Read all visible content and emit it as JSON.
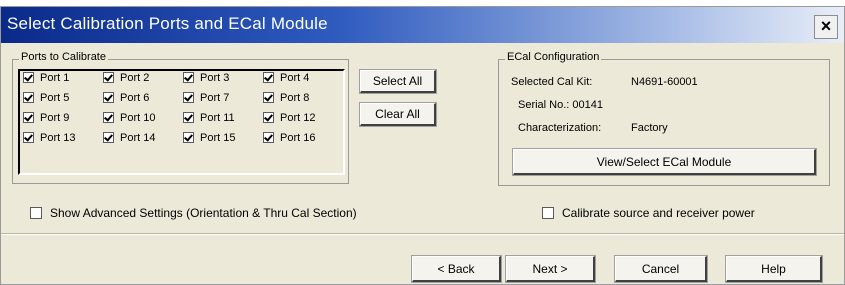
{
  "window": {
    "title": "Select Calibration Ports and ECal Module",
    "close_label": "×"
  },
  "ports_group": {
    "legend": "Ports to Calibrate",
    "ports": [
      {
        "label": "Port 1",
        "checked": true
      },
      {
        "label": "Port 2",
        "checked": true
      },
      {
        "label": "Port 3",
        "checked": true
      },
      {
        "label": "Port 4",
        "checked": true
      },
      {
        "label": "Port 5",
        "checked": true
      },
      {
        "label": "Port 6",
        "checked": true
      },
      {
        "label": "Port 7",
        "checked": true
      },
      {
        "label": "Port 8",
        "checked": true
      },
      {
        "label": "Port 9",
        "checked": true
      },
      {
        "label": "Port 10",
        "checked": true
      },
      {
        "label": "Port 11",
        "checked": true
      },
      {
        "label": "Port 12",
        "checked": true
      },
      {
        "label": "Port 13",
        "checked": true
      },
      {
        "label": "Port 14",
        "checked": true
      },
      {
        "label": "Port 15",
        "checked": true
      },
      {
        "label": "Port 16",
        "checked": true
      }
    ],
    "select_all_label": "Select All",
    "clear_all_label": "Clear All"
  },
  "ecal_group": {
    "legend": "ECal Configuration",
    "selected_cal_kit_label": "Selected Cal Kit:",
    "selected_cal_kit_value": "N4691-60001",
    "serial_label": "Serial No.: 00141",
    "characterization_label": "Characterization:",
    "characterization_value": "Factory",
    "view_select_label": "View/Select ECal Module"
  },
  "options": {
    "show_advanced_label": "Show Advanced Settings (Orientation & Thru Cal Section)",
    "show_advanced_checked": false,
    "calibrate_power_label": "Calibrate source and receiver power",
    "calibrate_power_checked": false
  },
  "footer": {
    "back_label": "< Back",
    "next_label": "Next >",
    "cancel_label": "Cancel",
    "help_label": "Help"
  }
}
